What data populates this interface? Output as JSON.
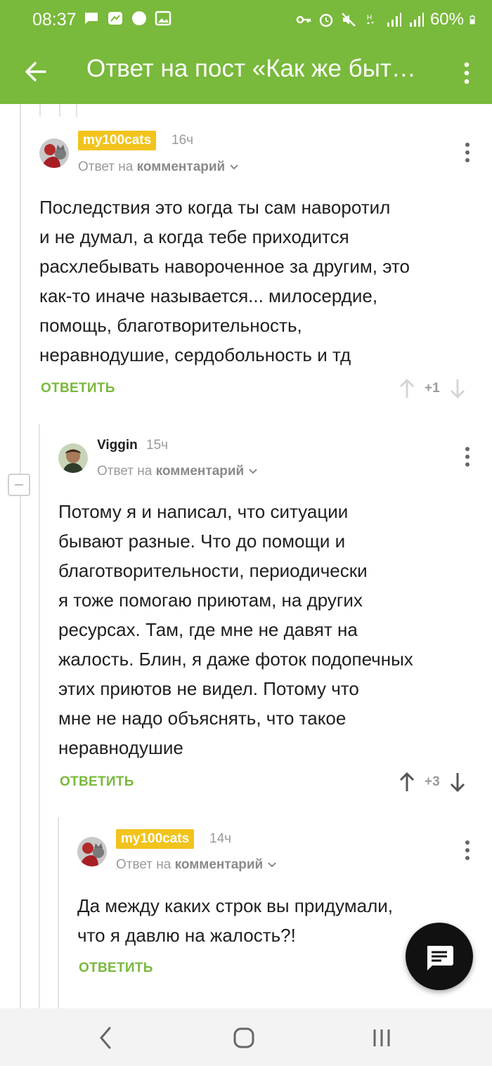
{
  "status": {
    "time": "08:37",
    "battery": "60%"
  },
  "appbar": {
    "title": "Ответ на пост «Как же быт…"
  },
  "colors": {
    "accent": "#79b93b",
    "badge": "#f2c31c",
    "text": "#1f1f1f",
    "muted": "#9a9a9a"
  },
  "comments": [
    {
      "author": "my100cats",
      "time": "16ч",
      "reply_prefix": "Ответ на",
      "reply_target": "комментарий",
      "text": "Последствия это когда ты сам наворотил\nи не думал, а когда тебе приходится\nрасхлебывать навороченное за другим, это\nкак-то иначе называется... милосердие,\nпомощь, благотворительность,\nнеравнодушие, сердобольность и тд",
      "reply_label": "ОТВЕТИТЬ",
      "rating": "+1"
    },
    {
      "author": "Viggin",
      "time": "15ч",
      "reply_prefix": "Ответ на",
      "reply_target": "комментарий",
      "text": "Потому я и написал, что ситуации\nбывают разные. Что до помощи и\nблаготворительности, периодически\nя тоже помогаю приютам, на других\nресурсах. Там, где мне не давят на\nжалость. Блин, я даже фоток подопечных\nэтих приютов не видел. Потому что\nмне не надо объяснять, что такое\nнеравнодушие",
      "reply_label": "ОТВЕТИТЬ",
      "rating": "+3"
    },
    {
      "author": "my100cats",
      "time": "14ч",
      "reply_prefix": "Ответ на",
      "reply_target": "комментарий",
      "text": "Да между каких строк вы придумали,\nчто я давлю на жалость?!",
      "reply_label": "ОТВЕТИТЬ"
    }
  ]
}
